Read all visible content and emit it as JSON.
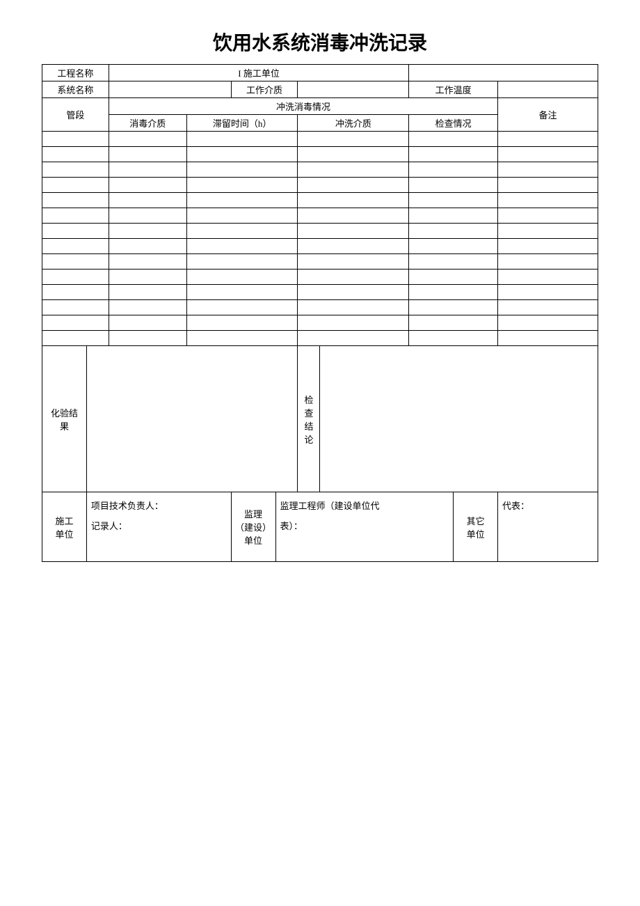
{
  "title": "饮用水系统消毒冲洗记录",
  "row1": {
    "project_name_label": "工程名称",
    "project_name_value": "",
    "construction_unit_label": "I 施工单位",
    "construction_unit_value": ""
  },
  "row2": {
    "system_name_label": "系统名称",
    "system_name_value": "",
    "working_medium_label": "工作介质",
    "working_medium_value": "",
    "working_temp_label": "工作温度",
    "working_temp_value": ""
  },
  "header": {
    "pipe_section": "管段",
    "flush_situation": "冲洗消毒情况",
    "remark": "备注",
    "disinfection_medium": "消毒介质",
    "retention_time": "滞留时间（h）",
    "flush_medium": "冲洗介质",
    "check_situation": "检查情况"
  },
  "rows": [
    [
      "",
      "",
      "",
      "",
      "",
      ""
    ],
    [
      "",
      "",
      "",
      "",
      "",
      ""
    ],
    [
      "",
      "",
      "",
      "",
      "",
      ""
    ],
    [
      "",
      "",
      "",
      "",
      "",
      ""
    ],
    [
      "",
      "",
      "",
      "",
      "",
      ""
    ],
    [
      "",
      "",
      "",
      "",
      "",
      ""
    ],
    [
      "",
      "",
      "",
      "",
      "",
      ""
    ],
    [
      "",
      "",
      "",
      "",
      "",
      ""
    ],
    [
      "",
      "",
      "",
      "",
      "",
      ""
    ],
    [
      "",
      "",
      "",
      "",
      "",
      ""
    ],
    [
      "",
      "",
      "",
      "",
      "",
      ""
    ],
    [
      "",
      "",
      "",
      "",
      "",
      ""
    ],
    [
      "",
      "",
      "",
      "",
      "",
      ""
    ],
    [
      "",
      "",
      "",
      "",
      "",
      ""
    ]
  ],
  "results": {
    "test_result_label": "化验结\n果",
    "test_result_value": "",
    "check_conclusion_label": "检查\n结论",
    "check_conclusion_value": ""
  },
  "signatures": {
    "construction_unit_label": "施工\n单位",
    "construction_unit_content": "项目技术负责人：\n记录人：",
    "supervision_unit_label": "监理\n（建设）\n单位",
    "supervision_unit_content": "监理工程师（建设单位代\n表）：",
    "other_unit_label": "其它\n单位",
    "other_unit_content": "代表："
  }
}
